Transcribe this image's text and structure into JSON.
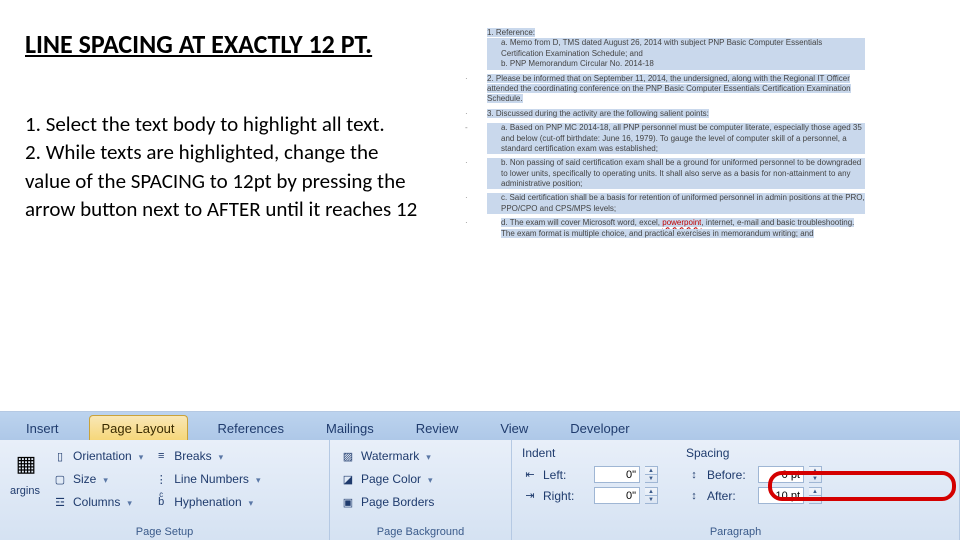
{
  "title": "LINE SPACING AT EXACTLY 12 PT.",
  "instructions": "1. Select the text body to highlight all text.\n2.  While texts are highlighted, change the value of the SPACING to 12pt by pressing the arrow button next to AFTER until it reaches 12",
  "doc": {
    "item1": "1.  Reference:",
    "item1a": "a.  Memo from D, TMS dated August 26, 2014 with subject PNP Basic Computer Essentials Certification Examination Schedule; and",
    "item1b": "b.  PNP Memorandum Circular No. 2014-18",
    "item2": "2.  Please be informed that on September 11, 2014, the undersigned, along with the Regional IT Officer  attended the coordinating conference on the PNP Basic Computer Essentials Certification Examination Schedule.",
    "item3": "3.  Discussed during the activity are the following salient points:",
    "item3a": "a.  Based on PNP MC 2014-18, all PNP personnel must be computer literate, especially those aged 35 and below (cut-off birthdate: June 16, 1979). To gauge the level of computer skill of a personnel, a standard certification exam was established;",
    "item3b": "b.  Non passing of said certification exam shall be a ground for uniformed personnel to be downgraded to lower units, specifically to operating units. It shall also serve as a basis for non-attainment to any administrative position;",
    "item3c": "c.  Said certification shall be a basis for retention of uniformed personnel in admin positions at the PRO, PPO/CPO and CPS/MPS levels;",
    "item3d_pre": "d.  The exam will cover Microsoft word, excel, ",
    "item3d_mark": "powerpoint",
    "item3d_post": ", internet, e-mail and basic troubleshooting. The exam format is multiple choice, and practical exercises in memorandum writing; and"
  },
  "ribbon": {
    "tabs": [
      "Insert",
      "Page Layout",
      "References",
      "Mailings",
      "Review",
      "View",
      "Developer"
    ],
    "active_tab_index": 1,
    "page_setup": {
      "title": "Page Setup",
      "margins_cut": "argins",
      "orientation": "Orientation",
      "size": "Size",
      "columns": "Columns",
      "breaks": "Breaks",
      "line_numbers": "Line Numbers",
      "hyphenation": "Hyphenation"
    },
    "page_background": {
      "title": "Page Background",
      "watermark": "Watermark",
      "page_color": "Page Color",
      "page_borders": "Page Borders"
    },
    "paragraph": {
      "title": "Paragraph",
      "indent_label": "Indent",
      "spacing_label": "Spacing",
      "left_label": "Left:",
      "right_label": "Right:",
      "before_label": "Before:",
      "after_label": "After:",
      "left_value": "0\"",
      "right_value": "0\"",
      "before_value": "0 pt",
      "after_value": "10 pt"
    }
  }
}
